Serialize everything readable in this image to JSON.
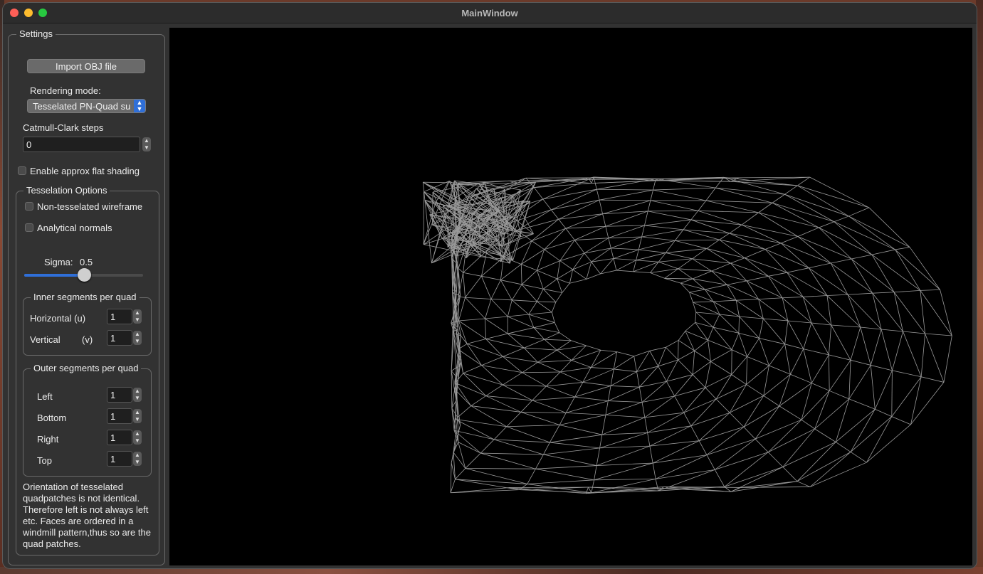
{
  "window": {
    "title": "MainWindow"
  },
  "settings": {
    "title": "Settings",
    "import_button": "Import OBJ file",
    "rendering_mode_label": "Rendering mode:",
    "rendering_mode_value": "Tesselated PN-Quad su",
    "catmull_label": "Catmull-Clark steps",
    "catmull_value": "0",
    "flat_shading_label": "Enable approx flat shading",
    "flat_shading_checked": false
  },
  "tess": {
    "title": "Tesselation Options",
    "wireframe_label": "Non-tesselated wireframe",
    "wireframe_checked": false,
    "normals_label": "Analytical normals",
    "normals_checked": false,
    "sigma_label": "Sigma:",
    "sigma_value": "0.5",
    "sigma_fraction": 0.5,
    "inner": {
      "title": "Inner segments per quad",
      "horizontal_label": "Horizontal  (u)",
      "horizontal_value": "1",
      "vertical_label": "Vertical",
      "vertical_unit": "(v)",
      "vertical_value": "1"
    },
    "outer": {
      "title": "Outer segments per quad",
      "left_label": "Left",
      "left_value": "1",
      "bottom_label": "Bottom",
      "bottom_value": "1",
      "right_label": "Right",
      "right_value": "1",
      "top_label": "Top",
      "top_value": "1"
    },
    "note": "Orientation of tesselated quadpatches is not identical. Therefore left is not always left etc. Faces are ordered in a windmill pattern,thus so are the quad patches."
  },
  "colors": {
    "accent": "#2f6fd8",
    "wireframe": "#9a9a9a",
    "viewport_bg": "#000000"
  }
}
